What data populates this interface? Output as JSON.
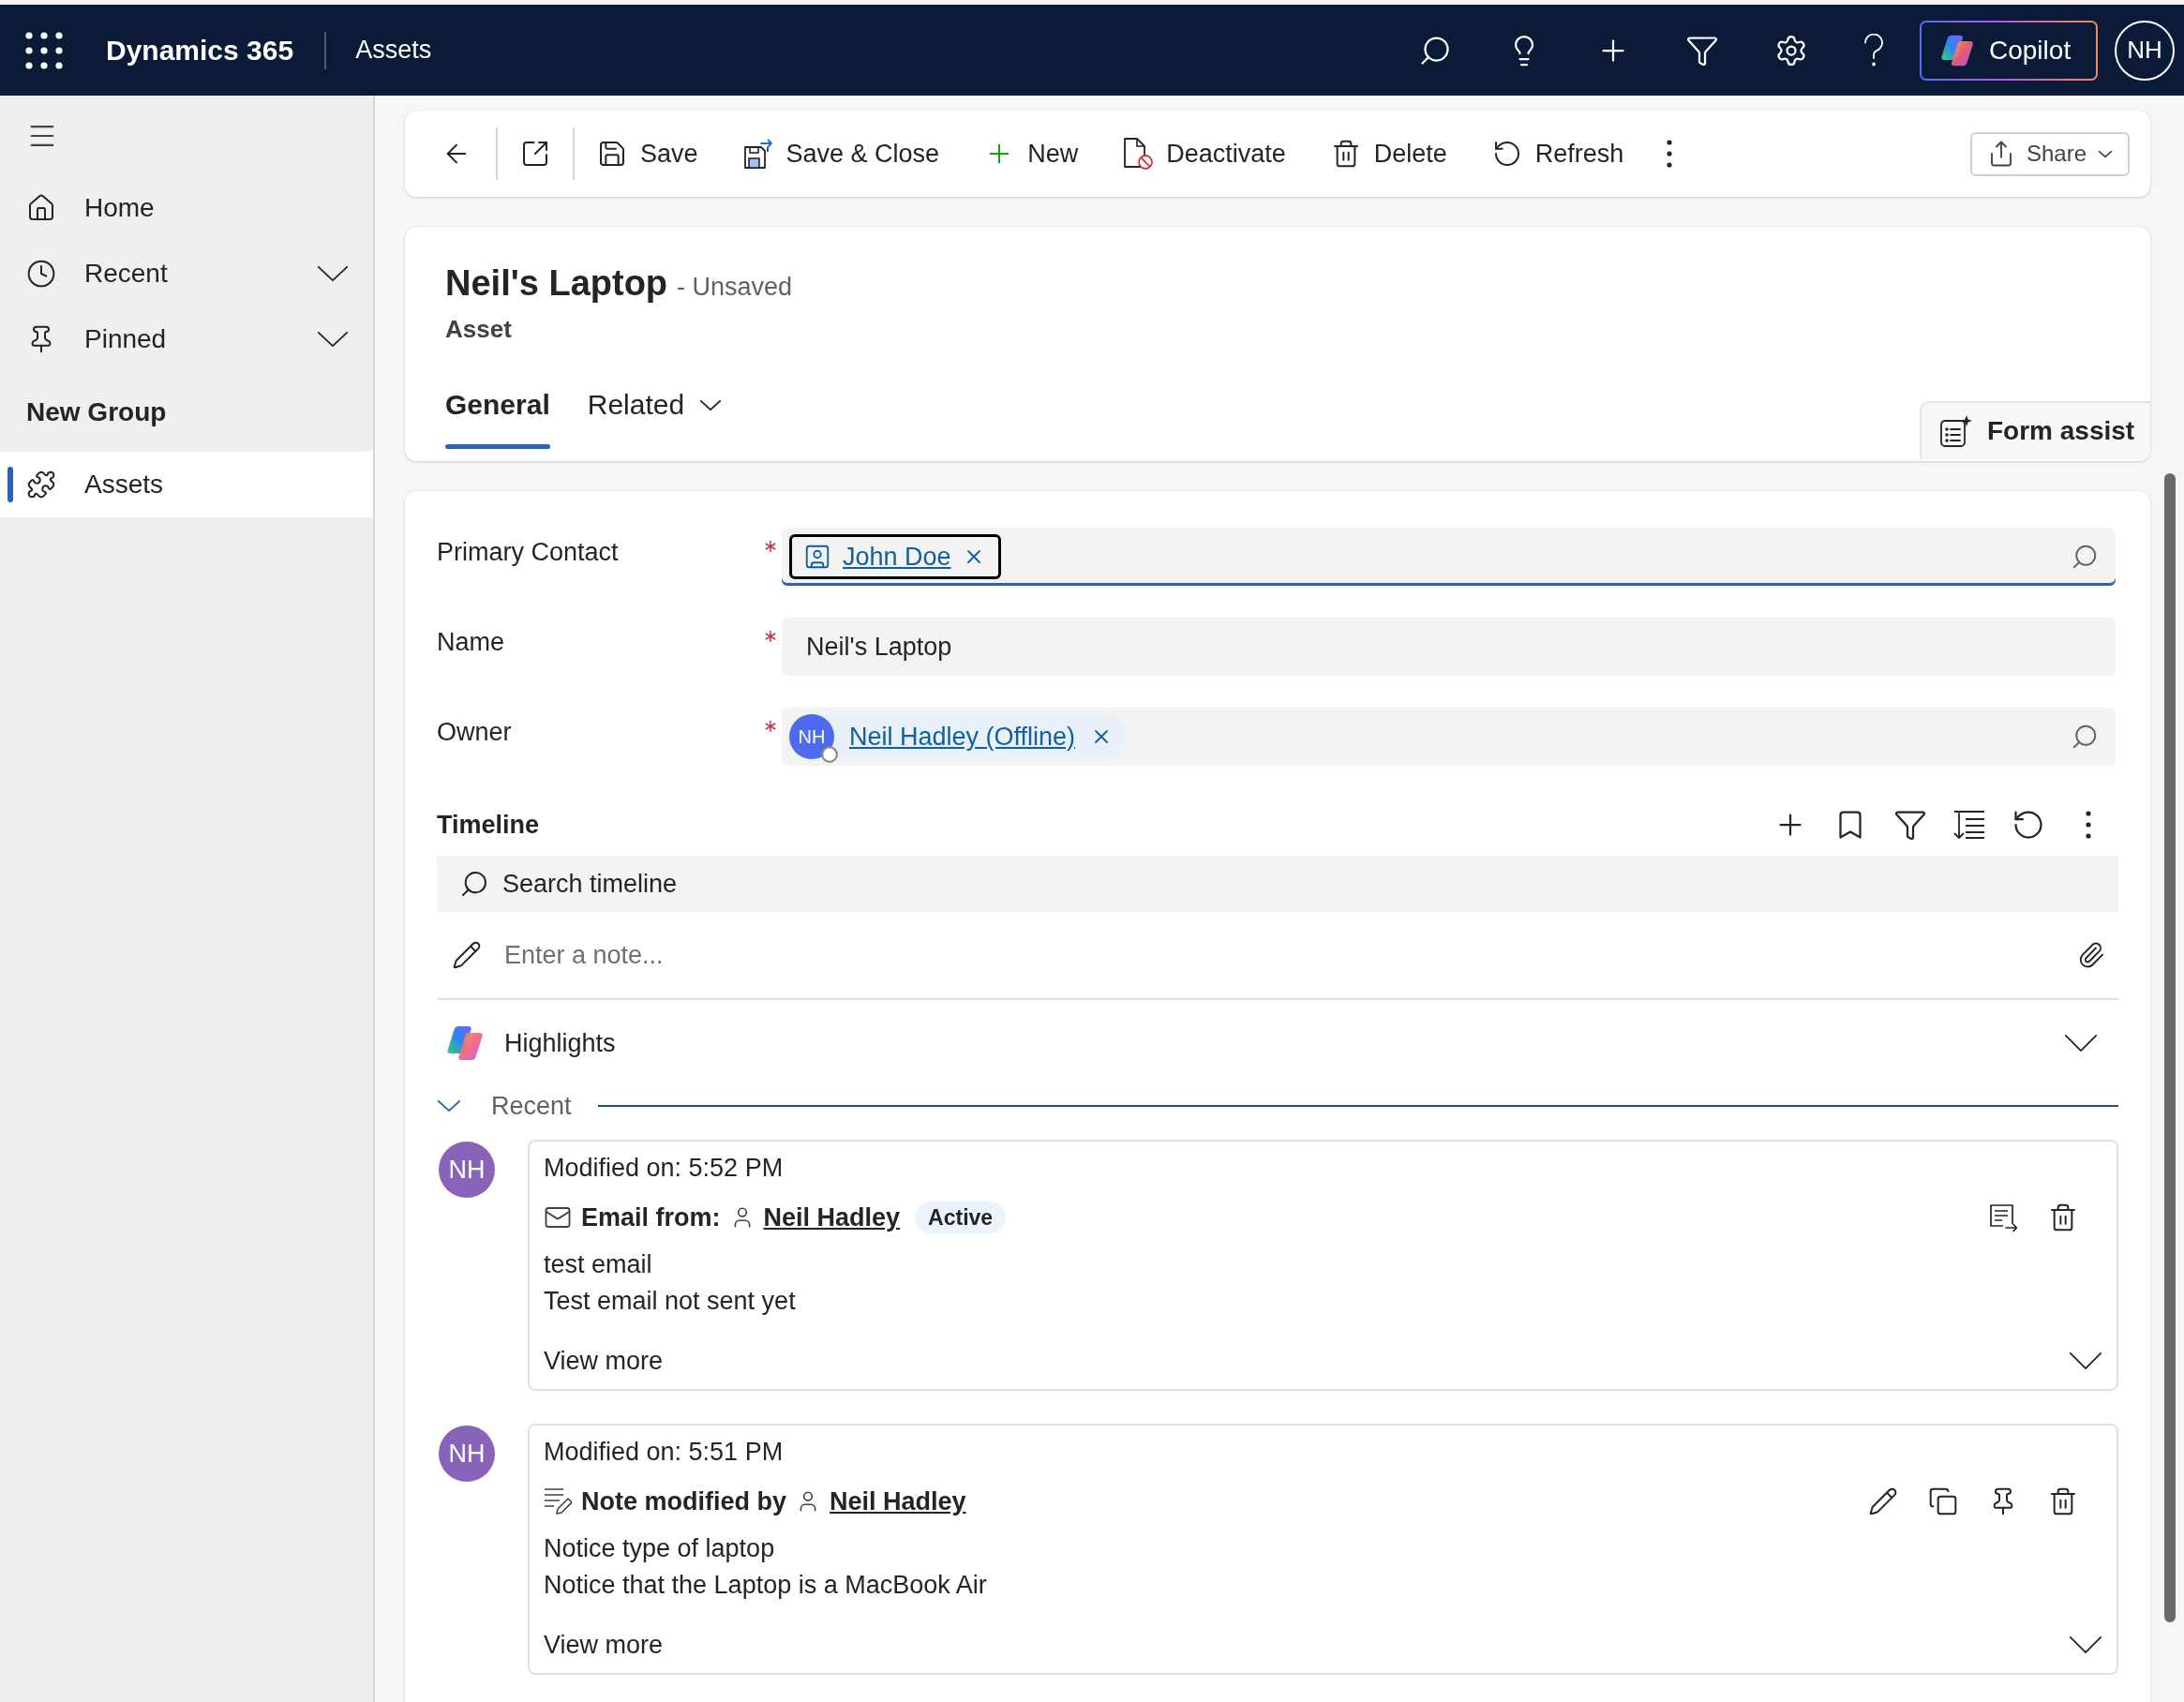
{
  "top_bar": {
    "app_name": "Dynamics 365",
    "area": "Assets",
    "copilot_label": "Copilot",
    "user_initials": "NH"
  },
  "sidebar": {
    "items": [
      {
        "kind": "home",
        "label": "Home",
        "expandable": false,
        "selected": false
      },
      {
        "kind": "recent",
        "label": "Recent",
        "expandable": true,
        "selected": false
      },
      {
        "kind": "pinned",
        "label": "Pinned",
        "expandable": true,
        "selected": false
      }
    ],
    "group_title": "New Group",
    "group_items": [
      {
        "kind": "entity",
        "label": "Assets",
        "expandable": false,
        "selected": true
      }
    ]
  },
  "command_bar": {
    "buttons": [
      {
        "kind": "save",
        "label": "Save"
      },
      {
        "kind": "save_close",
        "label": "Save & Close"
      },
      {
        "kind": "new",
        "label": "New"
      },
      {
        "kind": "deactivate",
        "label": "Deactivate"
      },
      {
        "kind": "delete",
        "label": "Delete"
      },
      {
        "kind": "refresh",
        "label": "Refresh"
      }
    ],
    "share_label": "Share"
  },
  "record": {
    "title": "Neil's Laptop",
    "save_status": "- Unsaved",
    "entity": "Asset",
    "tabs": [
      {
        "label": "General",
        "selected": true,
        "has_menu": false
      },
      {
        "label": "Related",
        "selected": false,
        "has_menu": true
      }
    ],
    "form_assist_label": "Form assist"
  },
  "fields": [
    {
      "kind": "contact_lookup",
      "label": "Primary Contact",
      "required": true,
      "focused": true,
      "value": "John Doe"
    },
    {
      "kind": "text",
      "label": "Name",
      "required": true,
      "focused": false,
      "value": "Neil's Laptop"
    },
    {
      "kind": "user_lookup",
      "label": "Owner",
      "required": true,
      "focused": false,
      "value": "Neil Hadley (Offline)",
      "initials": "NH"
    }
  ],
  "timeline": {
    "title": "Timeline",
    "search_placeholder": "Search timeline",
    "note_placeholder": "Enter a note...",
    "highlights_label": "Highlights",
    "highlights_expanded": false,
    "recent_label": "Recent",
    "recent_expanded": true,
    "items": [
      {
        "kind": "email",
        "initials": "NH",
        "modified": "Modified on: 5:52 PM",
        "title": "Email from:",
        "author": "Neil Hadley",
        "status": "Active",
        "lines": [
          "test email",
          "Test email not sent yet"
        ],
        "view_more": "View more",
        "expanded": false
      },
      {
        "kind": "note",
        "initials": "NH",
        "modified": "Modified on: 5:51 PM",
        "title": "Note modified by",
        "author": "Neil Hadley",
        "lines": [
          "Notice type of laptop",
          "Notice that the Laptop is a MacBook Air"
        ],
        "view_more": "View more",
        "expanded": false
      }
    ]
  }
}
